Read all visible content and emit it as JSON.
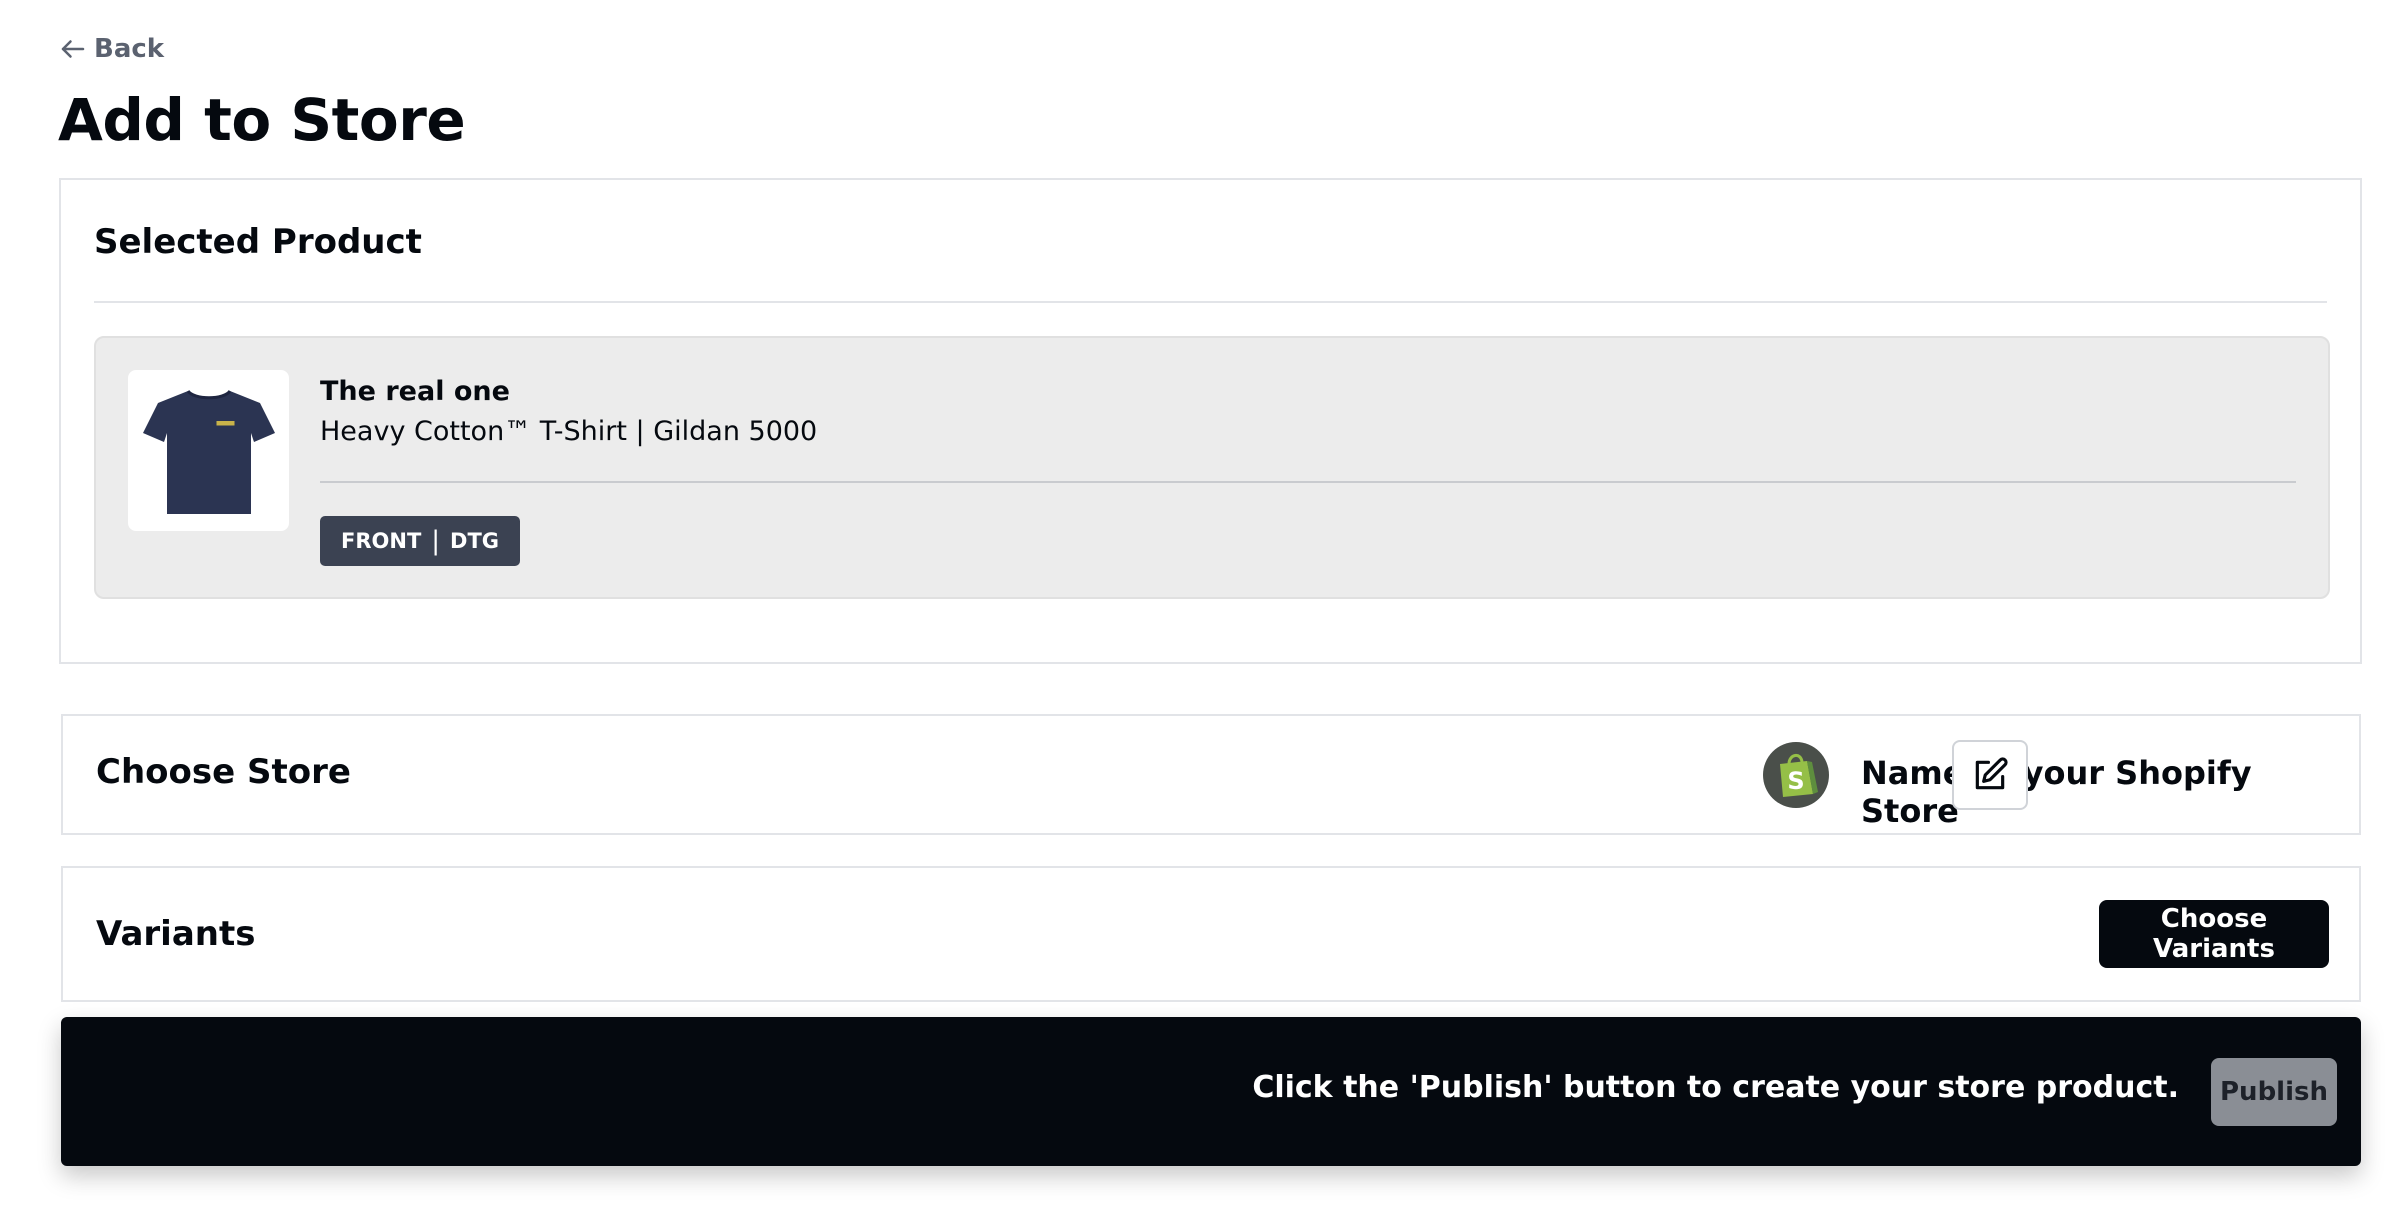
{
  "header": {
    "back_label": "Back",
    "page_title": "Add to Store"
  },
  "selected_product": {
    "section_title": "Selected Product",
    "product_name": "The real one",
    "product_description": "Heavy Cotton™ T-Shirt | Gildan 5000",
    "print_location": "FRONT",
    "print_separator": "|",
    "print_method": "DTG",
    "thumbnail_icon": "tshirt-image",
    "shirt_color": "#2b3452"
  },
  "choose_store": {
    "section_title": "Choose Store",
    "store_icon": "shopify-icon",
    "store_name": "Name of your Shopify Store",
    "edit_icon": "edit-icon"
  },
  "variants": {
    "section_title": "Variants",
    "button_label": "Choose Variants"
  },
  "publish": {
    "hint": "Click the 'Publish' button to create your store product.",
    "button_label": "Publish"
  }
}
